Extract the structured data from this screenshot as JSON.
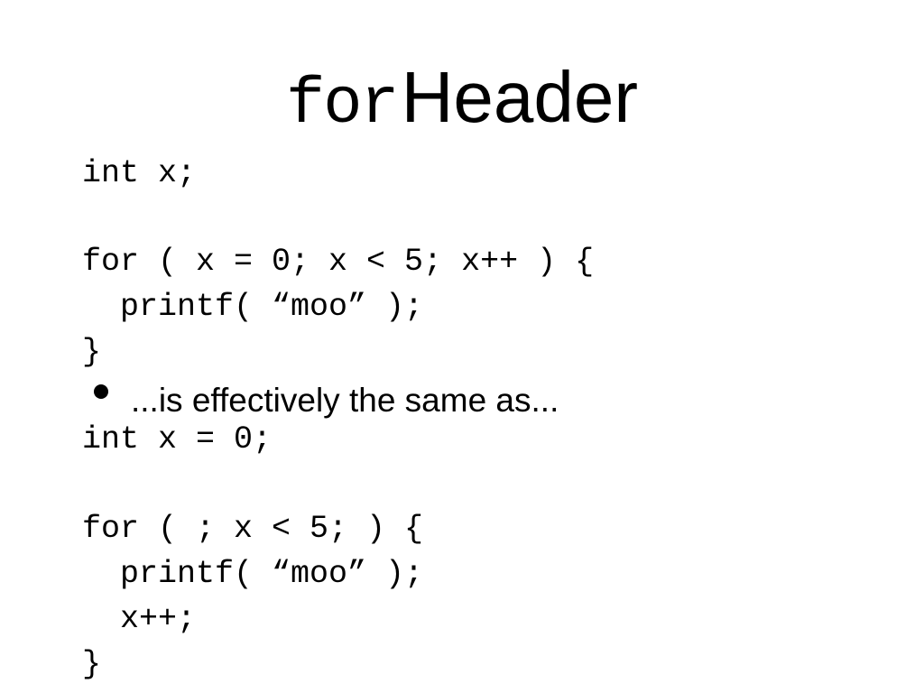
{
  "slide": {
    "title": {
      "code_part": "for",
      "text_part": "Header"
    },
    "code_block_1": [
      "int x;",
      "",
      "for ( x = 0; x < 5; x++ ) {",
      "  printf( “moo” );",
      "}"
    ],
    "bullet": {
      "icon": "bullet-dot",
      "text": "...is effectively the same as..."
    },
    "code_block_2": [
      "int x = 0;",
      "",
      "for ( ; x < 5; ) {",
      "  printf( “moo” );",
      "  x++;",
      "}"
    ]
  }
}
